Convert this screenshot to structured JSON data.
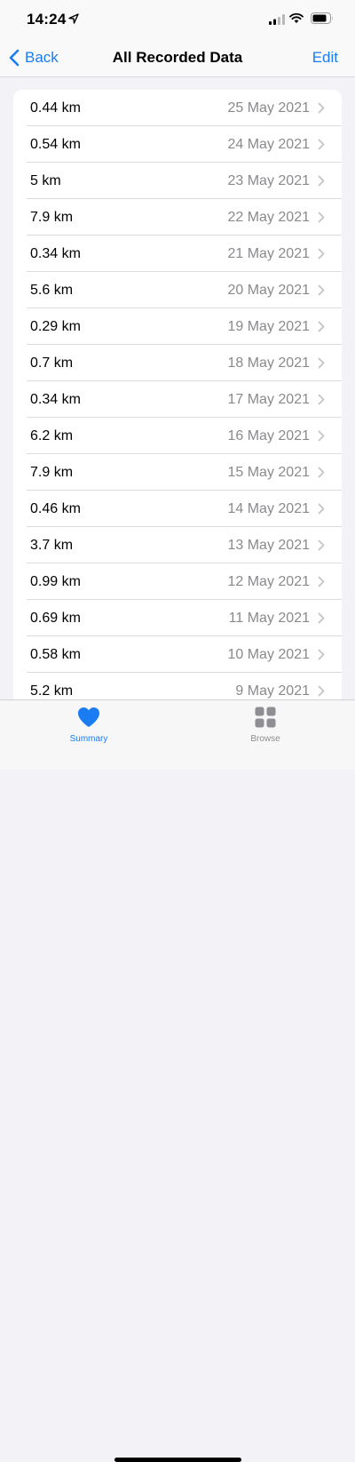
{
  "status_bar": {
    "time": "14:24"
  },
  "nav": {
    "back_label": "Back",
    "title": "All Recorded Data",
    "edit_label": "Edit"
  },
  "records": [
    {
      "value": "0.44 km",
      "date": "25 May 2021"
    },
    {
      "value": "0.54 km",
      "date": "24 May 2021"
    },
    {
      "value": "5 km",
      "date": "23 May 2021"
    },
    {
      "value": "7.9 km",
      "date": "22 May 2021"
    },
    {
      "value": "0.34 km",
      "date": "21 May 2021"
    },
    {
      "value": "5.6 km",
      "date": "20 May 2021"
    },
    {
      "value": "0.29 km",
      "date": "19 May 2021"
    },
    {
      "value": "0.7 km",
      "date": "18 May 2021"
    },
    {
      "value": "0.34 km",
      "date": "17 May 2021"
    },
    {
      "value": "6.2 km",
      "date": "16 May 2021"
    },
    {
      "value": "7.9 km",
      "date": "15 May 2021"
    },
    {
      "value": "0.46 km",
      "date": "14 May 2021"
    },
    {
      "value": "3.7 km",
      "date": "13 May 2021"
    },
    {
      "value": "0.99 km",
      "date": "12 May 2021"
    },
    {
      "value": "0.69 km",
      "date": "11 May 2021"
    },
    {
      "value": "0.58 km",
      "date": "10 May 2021"
    },
    {
      "value": "5.2 km",
      "date": "9 May 2021"
    }
  ],
  "tab_bar": {
    "tabs": [
      {
        "label": "Summary",
        "icon": "heart-icon",
        "active": true
      },
      {
        "label": "Browse",
        "icon": "grid-icon",
        "active": false
      }
    ]
  },
  "colors": {
    "accent": "#1a7cf2",
    "background": "#f2f2f7",
    "secondary_text": "#8a8a8e"
  }
}
